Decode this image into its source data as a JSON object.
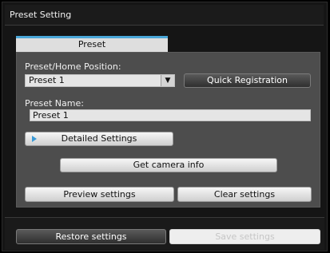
{
  "window": {
    "title": "Preset Setting"
  },
  "tabs": [
    {
      "label": "Preset"
    }
  ],
  "preset_home_position": {
    "label": "Preset/Home Position:",
    "selected": "Preset 1",
    "arrow": "▼"
  },
  "quick_registration_label": "Quick Registration",
  "preset_name": {
    "label": "Preset Name:",
    "value": "Preset 1"
  },
  "detailed_settings_label": "Detailed Settings",
  "get_camera_info_label": "Get camera info",
  "preview_settings_label": "Preview settings",
  "clear_settings_label": "Clear settings",
  "footer": {
    "restore_label": "Restore settings",
    "save_label": "Save settings"
  },
  "colors": {
    "accent": "#4aa7d8",
    "panel": "#4d4d4d",
    "background": "#151515"
  }
}
